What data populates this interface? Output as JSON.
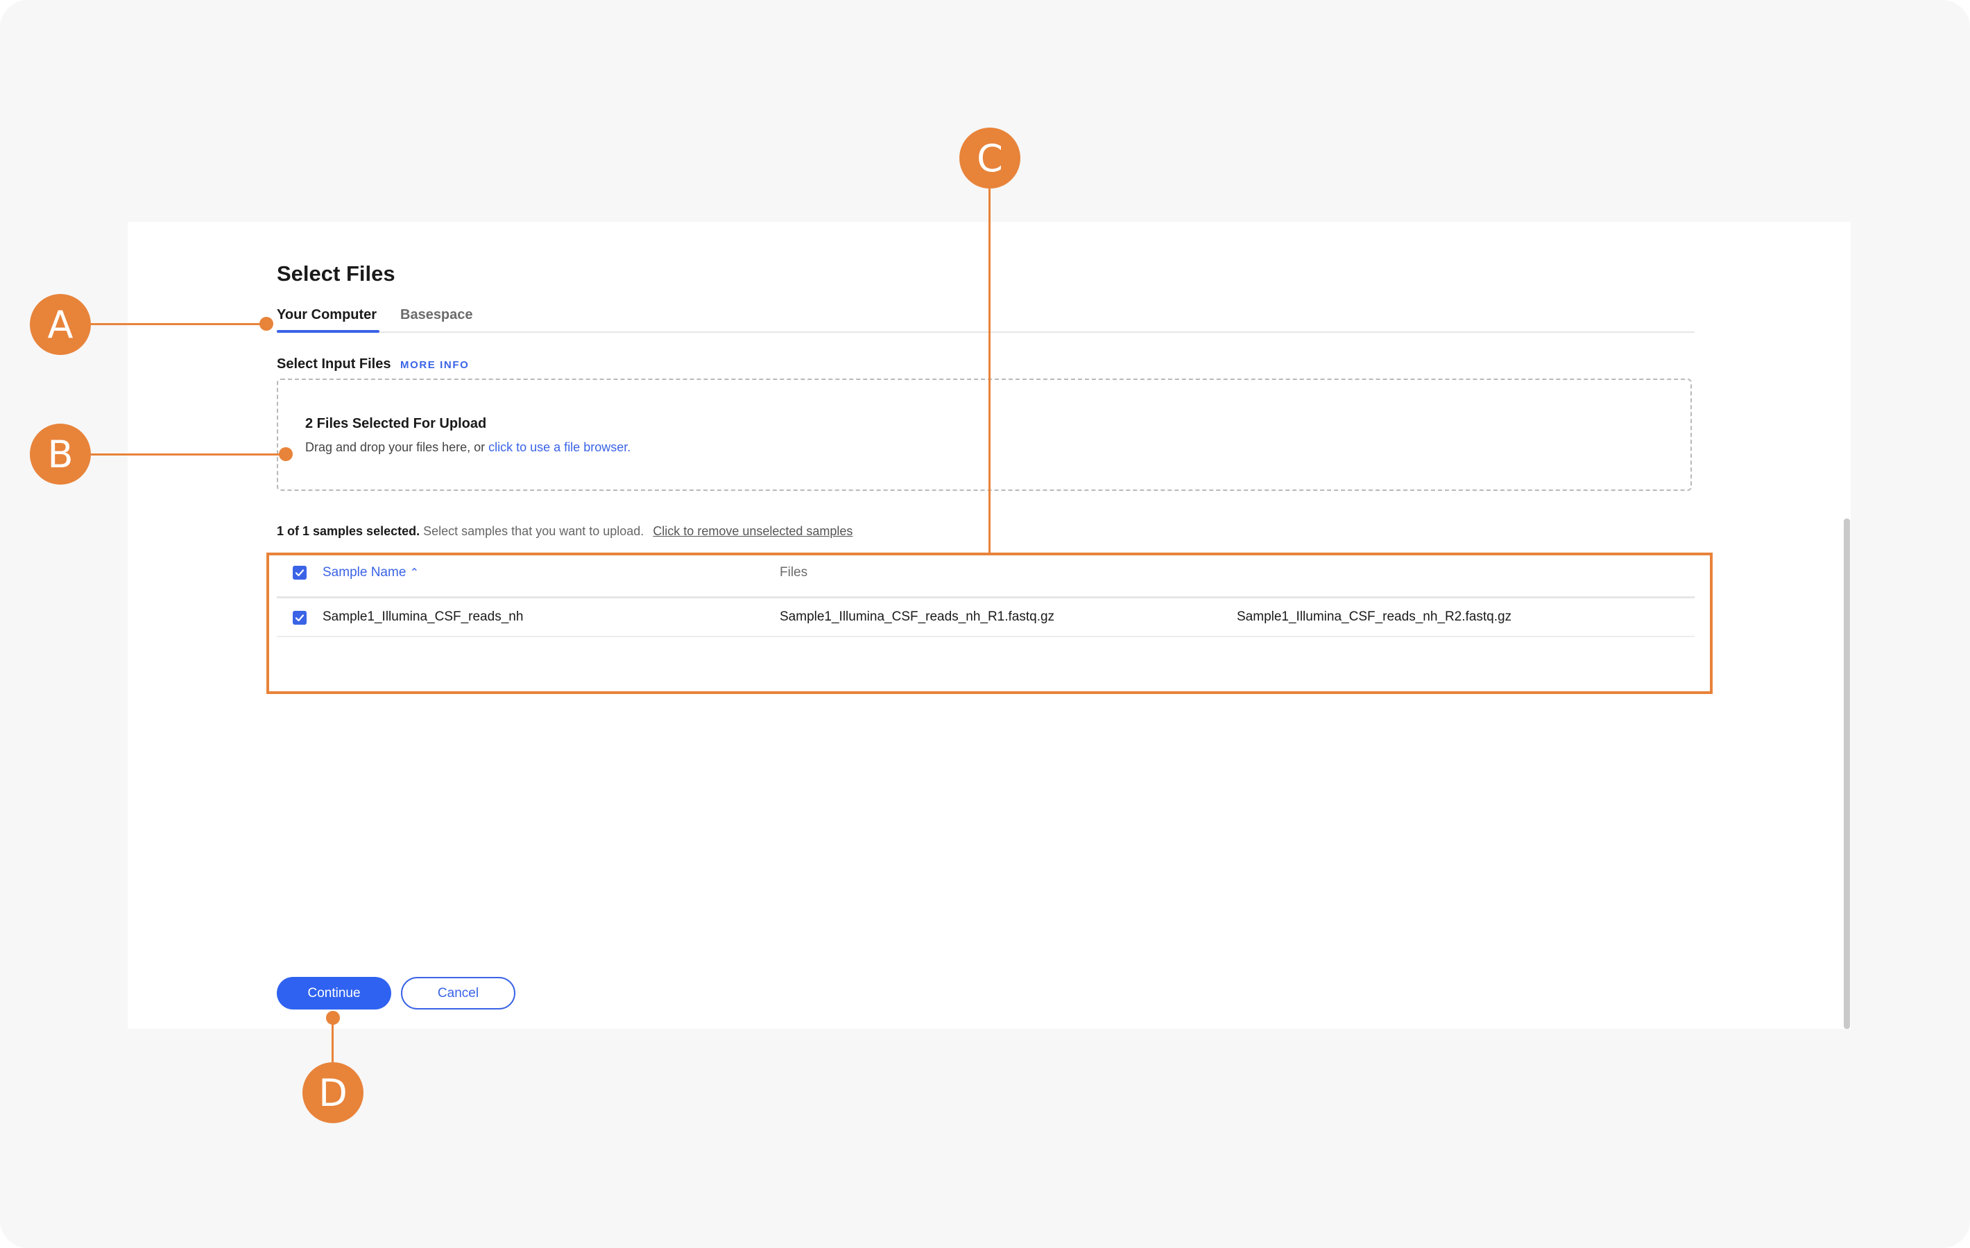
{
  "dialog": {
    "title": "Select Files",
    "tabs": [
      {
        "label": "Your Computer",
        "active": true
      },
      {
        "label": "Basespace",
        "active": false
      }
    ]
  },
  "input_section": {
    "label": "Select Input Files",
    "more_info": "MORE INFO"
  },
  "dropzone": {
    "title": "2 Files Selected For Upload",
    "text_prefix": "Drag and drop your files here, or ",
    "link": "click to use a file browser."
  },
  "selection_summary": {
    "count": "1 of 1 samples selected.",
    "hint": " Select samples that you want to upload. ",
    "remove_link": "Click to remove unselected samples"
  },
  "table": {
    "columns": [
      {
        "label": "Sample Name",
        "sort": "ascending"
      },
      {
        "label": "Files"
      }
    ],
    "header_checked": true,
    "rows": [
      {
        "checked": true,
        "sample_name": "Sample1_Illumina_CSF_reads_nh",
        "file_r1": "Sample1_Illumina_CSF_reads_nh_R1.fastq.gz",
        "file_r2": "Sample1_Illumina_CSF_reads_nh_R2.fastq.gz"
      }
    ]
  },
  "actions": {
    "continue": "Continue",
    "cancel": "Cancel"
  },
  "callouts": {
    "a": "A",
    "b": "B",
    "c": "C",
    "d": "D"
  },
  "colors": {
    "accent": "#3a63e6",
    "callout": "#e8833a",
    "background": "#f7f7f7"
  }
}
